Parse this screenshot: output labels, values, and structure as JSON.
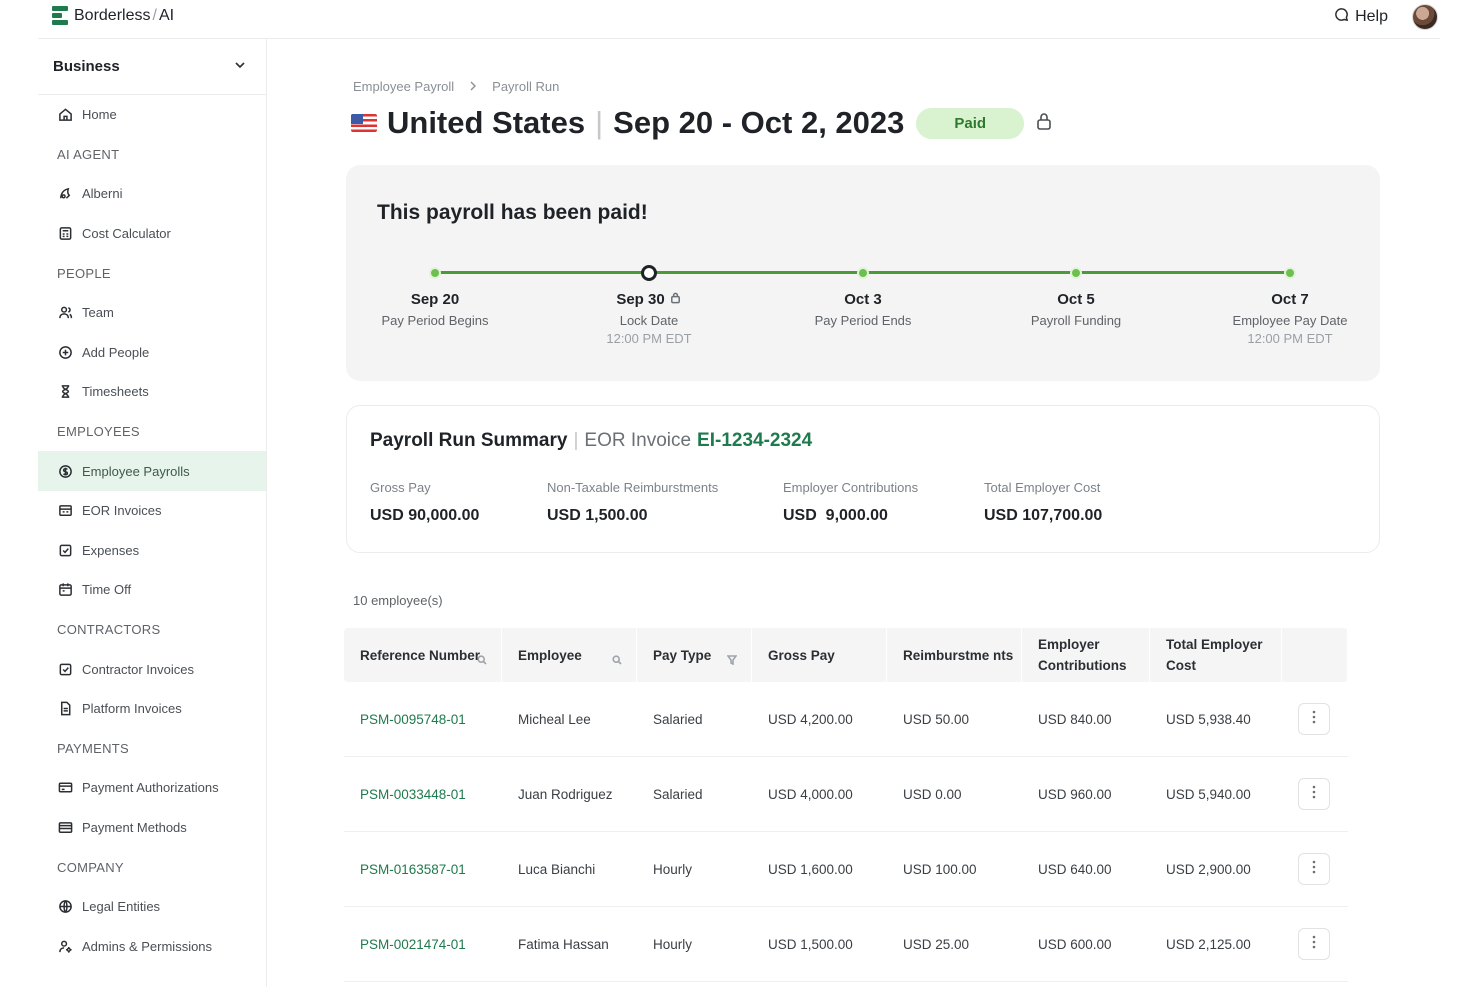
{
  "app": {
    "brand": "Borderless",
    "brand_suffix": "AI",
    "help_label": "Help"
  },
  "sidebar": {
    "workspace": "Business",
    "items": [
      {
        "type": "item",
        "label": "Home",
        "icon": "home-icon"
      },
      {
        "type": "section",
        "label": "AI AGENT"
      },
      {
        "type": "item",
        "label": "Alberni",
        "icon": "agent-icon"
      },
      {
        "type": "item",
        "label": "Cost Calculator",
        "icon": "calculator-icon"
      },
      {
        "type": "section",
        "label": "PEOPLE"
      },
      {
        "type": "item",
        "label": "Team",
        "icon": "team-icon"
      },
      {
        "type": "item",
        "label": "Add People",
        "icon": "add-circle-icon"
      },
      {
        "type": "item",
        "label": "Timesheets",
        "icon": "hourglass-icon"
      },
      {
        "type": "section",
        "label": "EMPLOYEES"
      },
      {
        "type": "item",
        "label": "Employee Payrolls",
        "icon": "dollar-circle-icon",
        "active": true
      },
      {
        "type": "item",
        "label": "EOR Invoices",
        "icon": "invoice-icon"
      },
      {
        "type": "item",
        "label": "Expenses",
        "icon": "expense-icon"
      },
      {
        "type": "item",
        "label": "Time Off",
        "icon": "calendar-icon"
      },
      {
        "type": "section",
        "label": "CONTRACTORS"
      },
      {
        "type": "item",
        "label": "Contractor Invoices",
        "icon": "contractor-invoice-icon"
      },
      {
        "type": "item",
        "label": "Platform Invoices",
        "icon": "document-icon"
      },
      {
        "type": "section",
        "label": "PAYMENTS"
      },
      {
        "type": "item",
        "label": "Payment Authorizations",
        "icon": "card-icon"
      },
      {
        "type": "item",
        "label": "Payment Methods",
        "icon": "wallet-icon"
      },
      {
        "type": "section",
        "label": "COMPANY"
      },
      {
        "type": "item",
        "label": "Legal Entities",
        "icon": "globe-icon"
      },
      {
        "type": "item",
        "label": "Admins & Permissions",
        "icon": "admin-icon"
      }
    ]
  },
  "breadcrumb": [
    "Employee Payroll",
    "Payroll Run"
  ],
  "header": {
    "country": "United States",
    "period": "Sep 20 - Oct 2, 2023",
    "status": "Paid"
  },
  "paid_card": {
    "title": "This payroll has been paid!",
    "steps": [
      {
        "date": "Sep 20",
        "label": "Pay Period Begins",
        "time": ""
      },
      {
        "date": "Sep 30",
        "label": "Lock Date",
        "time": "12:00 PM EDT",
        "current": true,
        "locked": true
      },
      {
        "date": "Oct 3",
        "label": "Pay Period Ends",
        "time": ""
      },
      {
        "date": "Oct 5",
        "label": "Payroll Funding",
        "time": ""
      },
      {
        "date": "Oct 7",
        "label": "Employee Pay Date",
        "time": "12:00 PM EDT"
      }
    ]
  },
  "summary": {
    "title": "Payroll Run Summary",
    "invoice_label": "EOR Invoice",
    "invoice_id": "EI-1234-2324",
    "metrics": [
      {
        "label": "Gross Pay",
        "value": "USD 90,000.00"
      },
      {
        "label": "Non-Taxable Reimburstments",
        "value": "USD 1,500.00"
      },
      {
        "label": "Employer Contributions",
        "value": "USD  9,000.00"
      },
      {
        "label": "Total Employer Cost",
        "value": "USD 107,700.00"
      }
    ]
  },
  "table": {
    "count_label": "10 employee(s)",
    "columns": [
      "Reference Number",
      "Employee",
      "Pay Type",
      "Gross Pay",
      "Reimburstme nts",
      "Employer Contributions",
      "Total Employer Cost",
      ""
    ],
    "rows": [
      [
        "PSM-0095748-01",
        "Micheal Lee",
        "Salaried",
        "USD 4,200.00",
        "USD 50.00",
        "USD 840.00",
        "USD 5,938.40"
      ],
      [
        "PSM-0033448-01",
        "Juan Rodriguez",
        "Salaried",
        "USD 4,000.00",
        "USD 0.00",
        "USD 960.00",
        "USD 5,940.00"
      ],
      [
        "PSM-0163587-01",
        "Luca Bianchi",
        "Hourly",
        "USD 1,600.00",
        "USD 100.00",
        "USD 640.00",
        "USD 2,900.00"
      ],
      [
        "PSM-0021474-01",
        "Fatima Hassan",
        "Hourly",
        "USD 1,500.00",
        "USD 25.00",
        "USD 600.00",
        "USD 2,125.00"
      ]
    ]
  },
  "colors": {
    "accent": "#1f7a4d",
    "active_bg": "#e6f4ec",
    "paid_badge_bg": "#d9f2cf",
    "timeline": "#4a9a3a"
  }
}
